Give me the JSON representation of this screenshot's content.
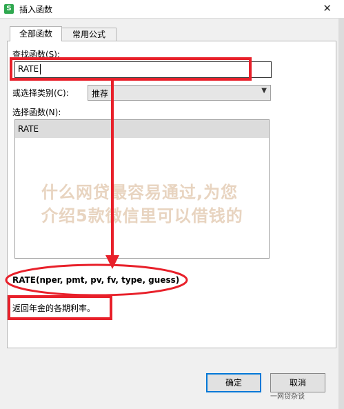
{
  "window": {
    "title": "插入函数",
    "app_icon": "S",
    "close": "✕"
  },
  "tabs": [
    {
      "label": "全部函数"
    },
    {
      "label": "常用公式"
    }
  ],
  "search": {
    "label": "查找函数(S):",
    "value": "RATE"
  },
  "category": {
    "label": "或选择类别(C):",
    "value": "推荐"
  },
  "func_list": {
    "label": "选择函数(N):",
    "items": [
      "RATE"
    ]
  },
  "syntax": "RATE(nper, pmt, pv, fv, type, guess)",
  "description": "返回年金的各期利率。",
  "buttons": {
    "ok": "确定",
    "cancel": "取消"
  },
  "watermark": {
    "line1": "什么网贷最容易通过,为您",
    "line2": "介绍5款微信里可以借钱的",
    "badge": "一网贷杂谈"
  },
  "colors": {
    "annotation": "#e8202a",
    "app_icon": "#2fa84f"
  }
}
